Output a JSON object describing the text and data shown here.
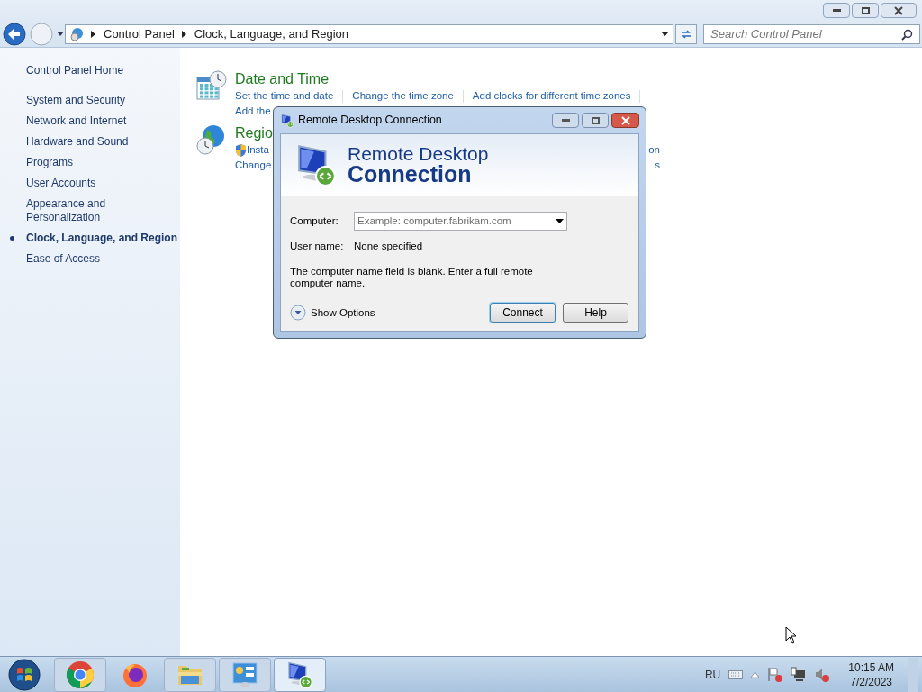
{
  "window": {
    "breadcrumb": [
      "Control Panel",
      "Clock, Language, and Region"
    ],
    "search": {
      "placeholder": "Search Control Panel"
    }
  },
  "sidebar": {
    "items": [
      {
        "label": "Control Panel Home",
        "selected": false,
        "kind": "home"
      },
      {
        "label": "System and Security",
        "selected": false,
        "kind": "category"
      },
      {
        "label": "Network and Internet",
        "selected": false,
        "kind": "category"
      },
      {
        "label": "Hardware and Sound",
        "selected": false,
        "kind": "category"
      },
      {
        "label": "Programs",
        "selected": false,
        "kind": "category"
      },
      {
        "label": "User Accounts",
        "selected": false,
        "kind": "category"
      },
      {
        "label": "Appearance and Personalization",
        "selected": false,
        "kind": "category"
      },
      {
        "label": "Clock, Language, and Region",
        "selected": true,
        "kind": "category"
      },
      {
        "label": "Ease of Access",
        "selected": false,
        "kind": "category"
      }
    ]
  },
  "sections": [
    {
      "kind": "clock",
      "title": "Date and Time",
      "rows": [
        [
          "Set the time and date",
          "Change the time zone",
          "Add clocks for different time zones"
        ],
        [
          "Add the"
        ]
      ]
    },
    {
      "kind": "globe",
      "title": "Regio",
      "rows": [
        [
          "Insta",
          "on"
        ],
        [
          "Change",
          "s"
        ]
      ]
    }
  ],
  "dialog": {
    "title": "Remote Desktop Connection",
    "banner_line1": "Remote Desktop",
    "banner_line2": "Connection",
    "computer_label": "Computer:",
    "computer_placeholder": "Example: computer.fabrikam.com",
    "user_label": "User name:",
    "user_value": "None specified",
    "message": "The computer name field is blank. Enter a full remote computer name.",
    "options_label": "Show Options",
    "buttons": [
      {
        "label": "Connect",
        "selected": true
      },
      {
        "label": "Help",
        "selected": false
      }
    ]
  },
  "taskbar": {
    "apps": [
      {
        "kind": "chrome",
        "running": true,
        "selected": false
      },
      {
        "kind": "firefox",
        "running": false,
        "selected": false
      },
      {
        "kind": "explorer",
        "running": true,
        "selected": false
      },
      {
        "kind": "control-panel",
        "running": true,
        "selected": false
      },
      {
        "kind": "remote-desktop",
        "running": true,
        "selected": true
      }
    ],
    "language": "RU",
    "time": "10:15 AM",
    "date": "7/2/2023"
  }
}
